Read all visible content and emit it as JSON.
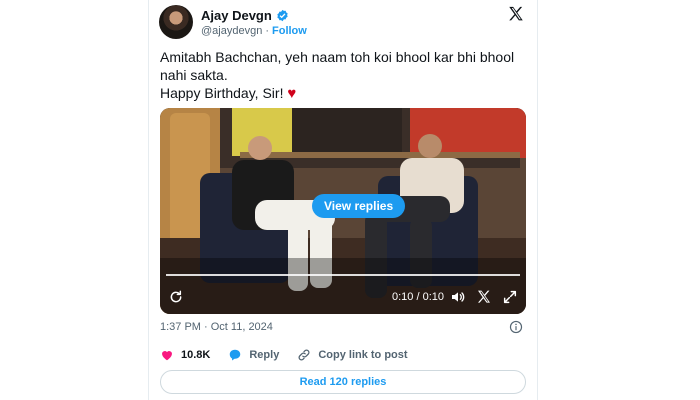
{
  "author": {
    "name": "Ajay Devgn",
    "handle": "@ajaydevgn",
    "separator": "·",
    "follow_label": "Follow",
    "verified_color": "#1d9bf0"
  },
  "tweet": {
    "line1": "Amitabh Bachchan, yeh naam toh koi bhool kar bhi bhool",
    "line2": "nahi sakta.",
    "line3": "Happy Birthday, Sir!",
    "emoji": "♥"
  },
  "video": {
    "view_replies_label": "View replies",
    "time": "0:10 / 0:10",
    "progress_fraction": 1.0,
    "icons": [
      "replay-icon",
      "volume-icon",
      "x-logo-icon",
      "fullscreen-icon"
    ]
  },
  "meta": {
    "timestamp": "1:37 PM · Oct 11, 2024"
  },
  "actions": {
    "likes": "10.8K",
    "reply_label": "Reply",
    "copy_link_label": "Copy link to post"
  },
  "read_replies_label": "Read 120 replies",
  "colors": {
    "accent": "#1d9bf0",
    "like": "#f91880",
    "text": "#0f1419",
    "muted": "#536471"
  }
}
